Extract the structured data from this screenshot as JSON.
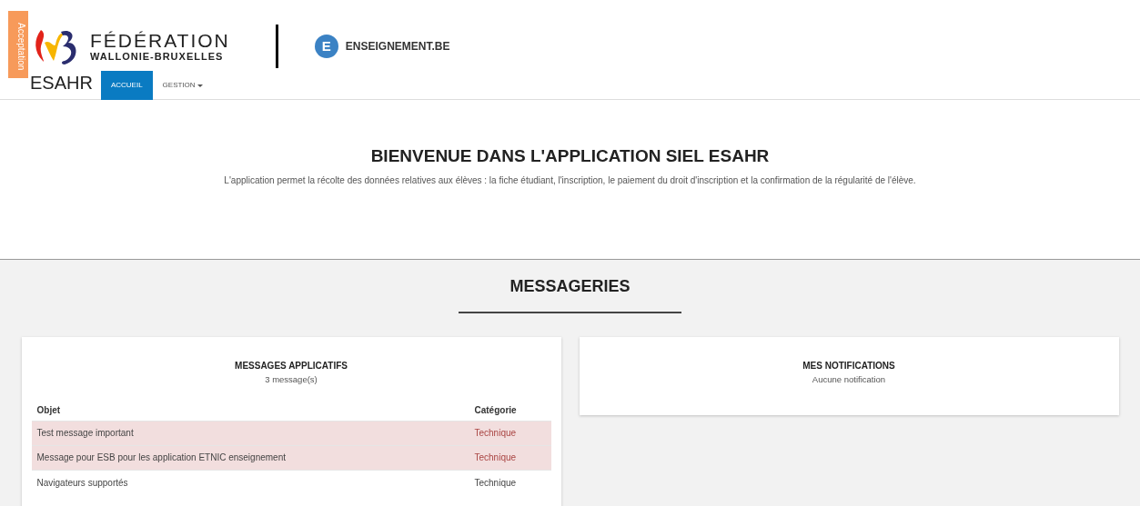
{
  "env_badge": "Acceptation",
  "logo": {
    "line1": "FÉDÉRATION",
    "line2": "WALLONIE-BRUXELLES"
  },
  "partner": {
    "letter": "E",
    "name": "ENSEIGNEMENT.BE"
  },
  "app_name": "ESAHR",
  "nav": [
    {
      "label": "ACCUEIL",
      "selected": true,
      "dropdown": false
    },
    {
      "label": "GESTION",
      "selected": false,
      "dropdown": true
    }
  ],
  "welcome": {
    "title": "BIENVENUE DANS L'APPLICATION SIEL ESAHR",
    "text": "L'application permet la récolte des données relatives aux élèves : la fiche étudiant, l'inscription, le paiement du droit d'inscription et la confirmation de la régularité de l'élève."
  },
  "section_title": "MESSAGERIES",
  "messages": {
    "title": "MESSAGES APPLICATIFS",
    "count": "3 message(s)",
    "columns": [
      "Objet",
      "Catégorie"
    ],
    "rows": [
      {
        "subject": "Test message important",
        "category": "Technique",
        "important": true
      },
      {
        "subject": "Message pour ESB pour les application ETNIC enseignement",
        "category": "Technique",
        "important": true
      },
      {
        "subject": "Navigateurs supportés",
        "category": "Technique",
        "important": false
      }
    ]
  },
  "notifications": {
    "title": "MES NOTIFICATIONS",
    "text": "Aucune notification"
  }
}
